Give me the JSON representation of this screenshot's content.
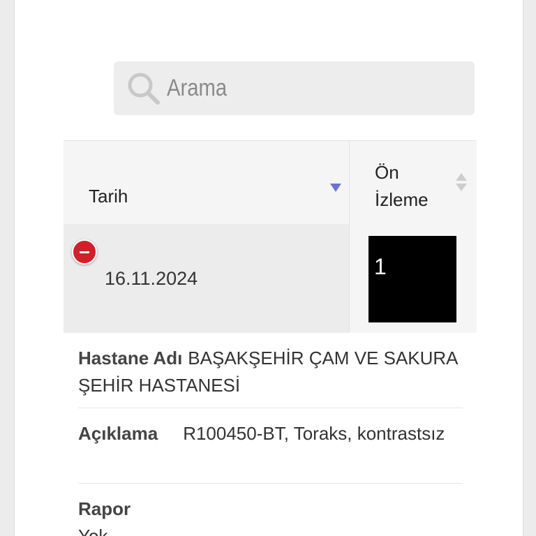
{
  "search": {
    "placeholder": "Arama"
  },
  "table": {
    "columns": {
      "date": "Tarih",
      "preview": "Ön İzleme"
    },
    "rows": [
      {
        "date": "16.11.2024",
        "preview_label": "1"
      }
    ]
  },
  "details": {
    "hospital_label": "Hastane Adı",
    "hospital_value": "BAŞAKŞEHİR ÇAM VE SAKURA ŞEHİR HASTANESİ",
    "description_label": "Açıklama",
    "description_value": "R100450-BT, Toraks, kontrastsız",
    "report_label": "Rapor",
    "report_value": "Yok"
  },
  "colors": {
    "collapse": "#d2202a",
    "sort_active": "#6d72d6"
  }
}
